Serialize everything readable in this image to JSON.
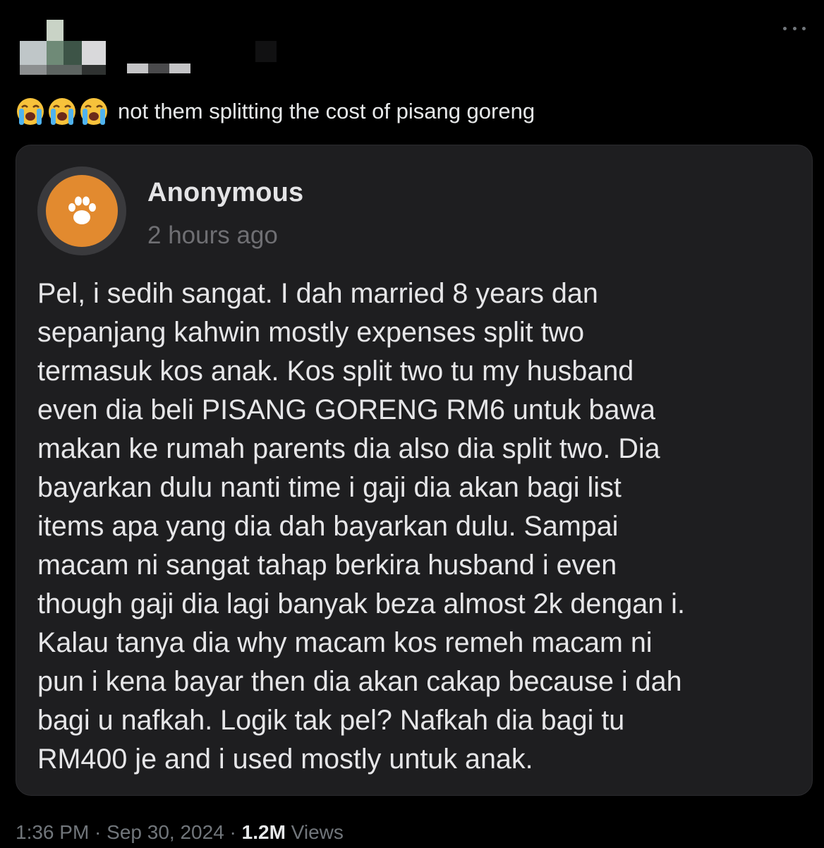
{
  "tweet": {
    "text": "not them splitting the cost of pisang goreng",
    "emojis": [
      "loudly-crying-face",
      "loudly-crying-face",
      "loudly-crying-face"
    ]
  },
  "card": {
    "author": "Anonymous",
    "time_ago": "2 hours ago",
    "avatar_icon": "paw-icon",
    "avatar_color": "#e28a2f",
    "body_lines": [
      "Pel, i sedih sangat. I dah married 8 years dan",
      "sepanjang kahwin mostly expenses split two",
      "termasuk kos anak. Kos split two tu my husband",
      "even dia beli PISANG GORENG RM6 untuk bawa",
      "makan ke rumah parents dia also dia split two. Dia",
      "bayarkan dulu nanti time i gaji dia akan bagi list",
      "items apa yang dia dah bayarkan dulu. Sampai",
      "macam ni sangat tahap berkira husband i even",
      "though gaji dia lagi banyak beza almost 2k dengan i.",
      "Kalau tanya dia why macam kos remeh macam ni",
      "pun i kena bayar then dia akan cakap because i dah",
      "bagi u nafkah. Logik tak pel? Nafkah dia bagi tu",
      "RM400 je and i used mostly untuk anak."
    ]
  },
  "meta": {
    "time": "1:36 PM",
    "separator": " · ",
    "date": "Sep 30, 2024",
    "views_count": "1.2M",
    "views_label": " Views"
  }
}
